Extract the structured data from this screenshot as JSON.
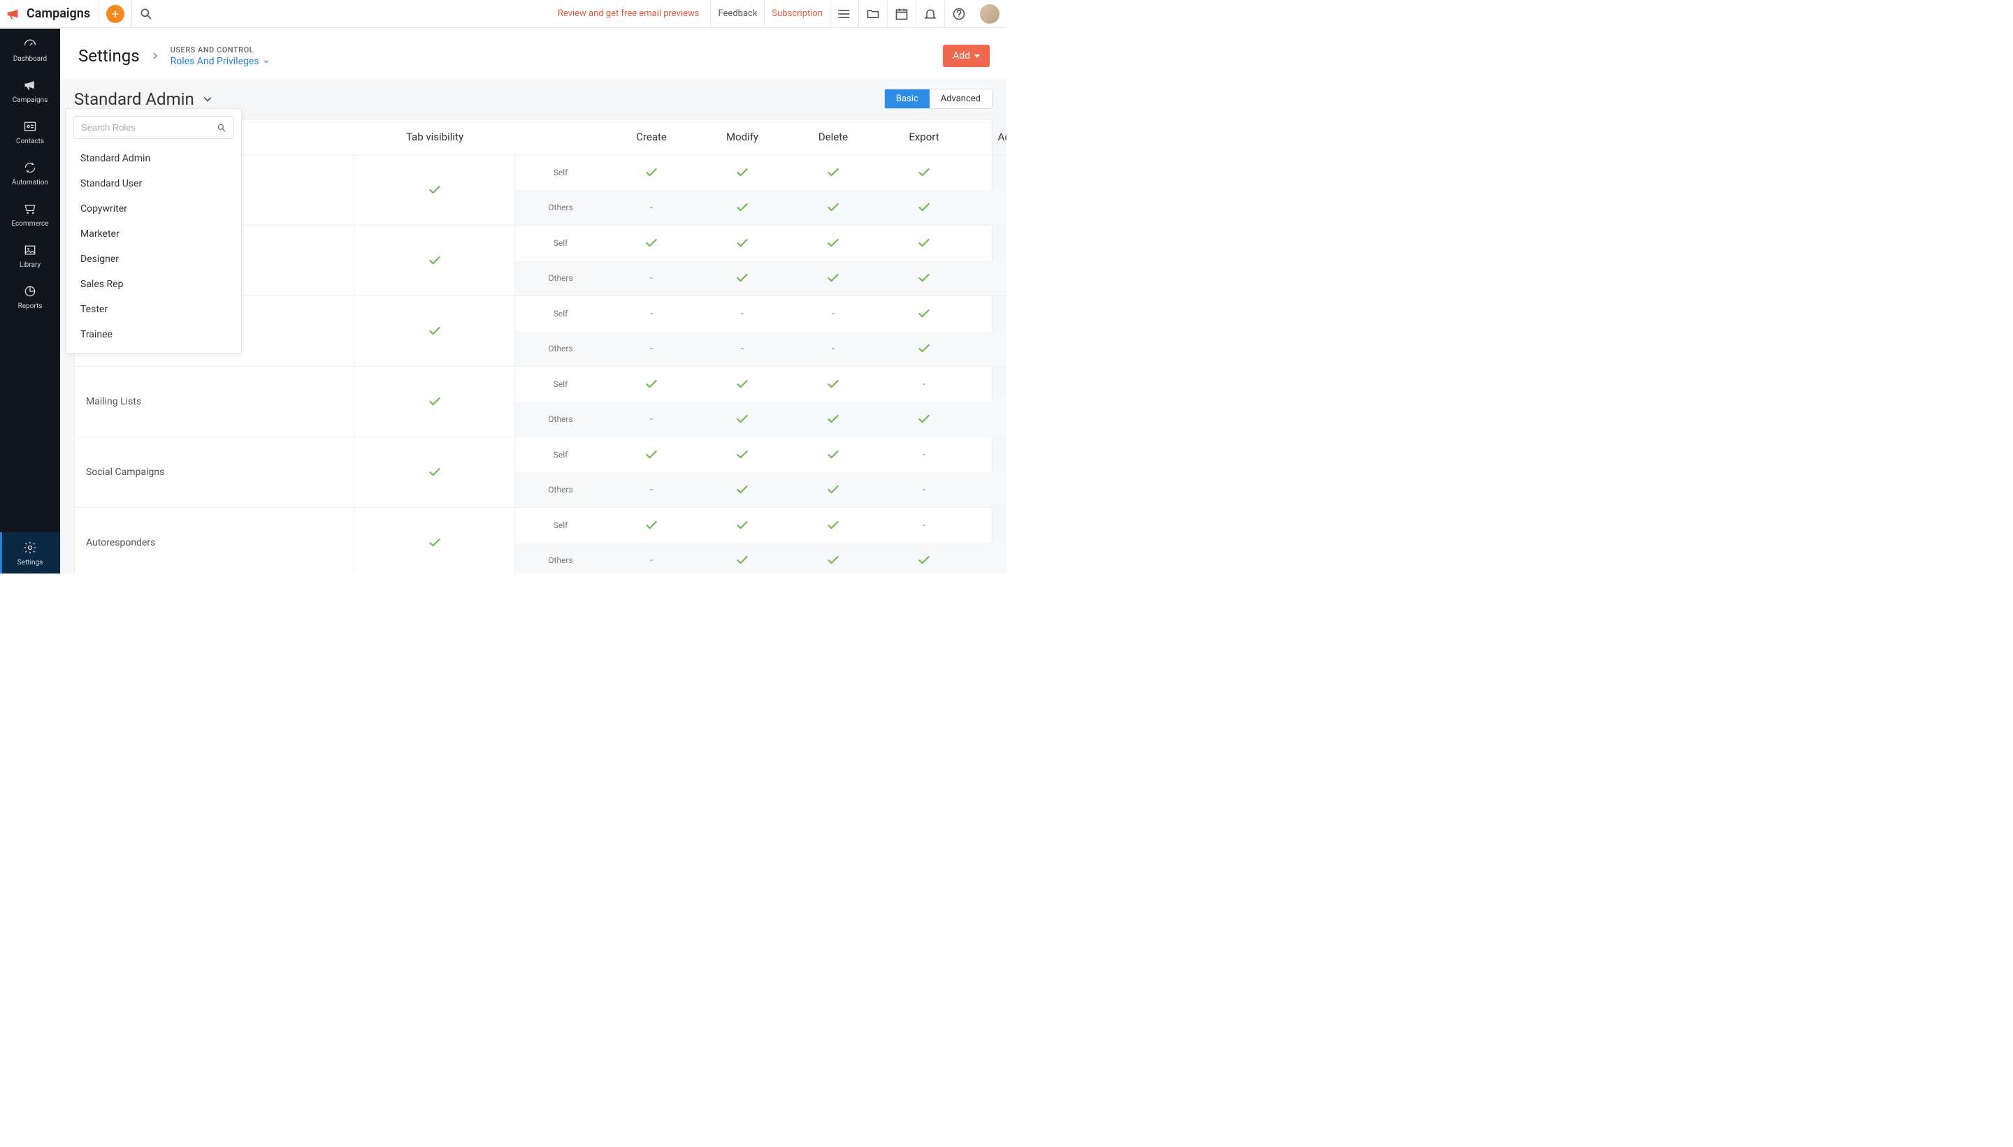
{
  "brand": {
    "name": "Campaigns"
  },
  "topbar": {
    "review_link": "Review and get free email previews",
    "feedback": "Feedback",
    "subscription": "Subscription"
  },
  "sidebar": {
    "items": [
      {
        "id": "dashboard",
        "label": "Dashboard"
      },
      {
        "id": "campaigns",
        "label": "Campaigns"
      },
      {
        "id": "contacts",
        "label": "Contacts"
      },
      {
        "id": "automation",
        "label": "Automation"
      },
      {
        "id": "ecommerce",
        "label": "Ecommerce"
      },
      {
        "id": "library",
        "label": "Library"
      },
      {
        "id": "reports",
        "label": "Reports"
      }
    ],
    "bottom": {
      "id": "settings",
      "label": "Settings"
    }
  },
  "page": {
    "title": "Settings",
    "breadcrumb_category": "USERS AND CONTROL",
    "breadcrumb_page": "Roles And Privileges",
    "add_button": "Add"
  },
  "role_picker": {
    "selected": "Standard Admin",
    "search_placeholder": "Search Roles",
    "options": [
      "Standard Admin",
      "Standard User",
      "Copywriter",
      "Marketer",
      "Designer",
      "Sales Rep",
      "Tester",
      "Trainee"
    ]
  },
  "view_toggle": {
    "basic": "Basic",
    "advanced": "Advanced"
  },
  "table": {
    "headers": [
      "",
      "Tab visibility",
      "Create",
      "Modify",
      "Delete",
      "Export",
      "Access"
    ],
    "scope_self": "Self",
    "scope_others": "Others",
    "rows": [
      {
        "feature": "",
        "tab_visibility": true,
        "self": {
          "create": true,
          "modify": true,
          "delete": true,
          "export": true,
          "access": true
        },
        "others": {
          "create": false,
          "modify": true,
          "delete": true,
          "export": true,
          "access": true
        }
      },
      {
        "feature": "",
        "tab_visibility": true,
        "self": {
          "create": true,
          "modify": true,
          "delete": true,
          "export": true,
          "access": true
        },
        "others": {
          "create": false,
          "modify": true,
          "delete": true,
          "export": true,
          "access": true
        }
      },
      {
        "feature": "",
        "tab_visibility": true,
        "self": {
          "create": false,
          "modify": false,
          "delete": false,
          "export": true,
          "access": true
        },
        "others": {
          "create": false,
          "modify": false,
          "delete": false,
          "export": true,
          "access": true
        }
      },
      {
        "feature": "Mailing Lists",
        "tab_visibility": true,
        "self": {
          "create": true,
          "modify": true,
          "delete": true,
          "export": false,
          "access": true
        },
        "others": {
          "create": false,
          "modify": true,
          "delete": true,
          "export": true,
          "access": true
        }
      },
      {
        "feature": "Social Campaigns",
        "tab_visibility": true,
        "self": {
          "create": true,
          "modify": true,
          "delete": true,
          "export": false,
          "access": true
        },
        "others": {
          "create": false,
          "modify": true,
          "delete": true,
          "export": false,
          "access": true
        }
      },
      {
        "feature": "Autoresponders",
        "tab_visibility": true,
        "self": {
          "create": true,
          "modify": true,
          "delete": true,
          "export": false,
          "access": true
        },
        "others": {
          "create": false,
          "modify": true,
          "delete": true,
          "export": true,
          "access": true
        }
      }
    ]
  }
}
